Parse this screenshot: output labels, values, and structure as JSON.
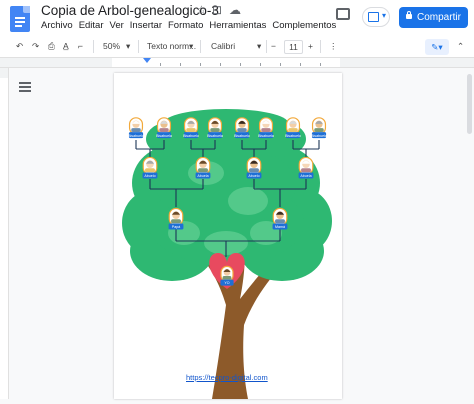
{
  "doc": {
    "title": "Copia de Arbol-genealogico-3",
    "title_icons": [
      "star-icon",
      "move-to-folder-icon",
      "cloud-status-icon"
    ],
    "menu": [
      "Archivo",
      "Editar",
      "Ver",
      "Insertar",
      "Formato",
      "Herramientas",
      "Complementos"
    ]
  },
  "header": {
    "share_label": "Compartir"
  },
  "toolbar": {
    "zoom": "50%",
    "style": "Texto norm...",
    "font": "Calibri",
    "font_size": "11"
  },
  "tree": {
    "great_grandparents": [
      "Bisabuelo",
      "Bisabuela",
      "Bisabuelo",
      "Bisabuela",
      "Bisabuelo",
      "Bisabuela",
      "Bisabuelo",
      "Bisabuela"
    ],
    "grandparents": [
      "Abuelo",
      "Abuela",
      "Abuelo",
      "Abuela"
    ],
    "parents": [
      "Papá",
      "Mamá"
    ],
    "me": "YO",
    "link": "https://tecpro-digital.com"
  },
  "colors": {
    "accent": "#1a73e8",
    "tree_green": "#2eb872",
    "trunk": "#8d5a2a",
    "heart": "#e84a5f",
    "label_blue": "#1e6fd6"
  }
}
